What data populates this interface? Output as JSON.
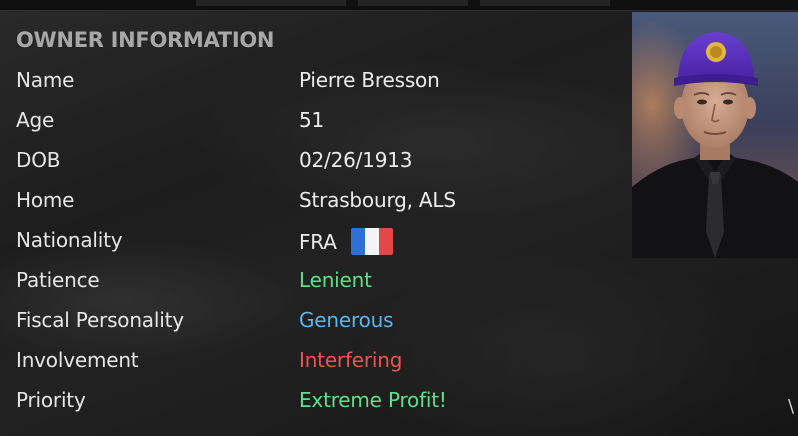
{
  "header": {
    "title": "OWNER INFORMATION"
  },
  "owner": {
    "rows": [
      {
        "label": "Name",
        "value": "Pierre Bresson"
      },
      {
        "label": "Age",
        "value": "51"
      },
      {
        "label": "DOB",
        "value": "02/26/1913"
      },
      {
        "label": "Home",
        "value": "Strasbourg, ALS"
      },
      {
        "label": "Nationality",
        "value": "FRA"
      },
      {
        "label": "Patience",
        "value": "Lenient"
      },
      {
        "label": "Fiscal Personality",
        "value": "Generous"
      },
      {
        "label": "Involvement",
        "value": "Interfering"
      },
      {
        "label": "Priority",
        "value": "Extreme Profit!"
      }
    ]
  },
  "flag": {
    "icon": "france-flag-icon",
    "colors": [
      "#2f6fd6",
      "#f4f4f4",
      "#e34848"
    ]
  },
  "colors": {
    "green": "#5fe08a",
    "blue": "#59b6ef",
    "red": "#f05252",
    "header": "#a8a8a8",
    "text": "#e6e6e6"
  },
  "corner": {
    "glyph": "\\"
  }
}
